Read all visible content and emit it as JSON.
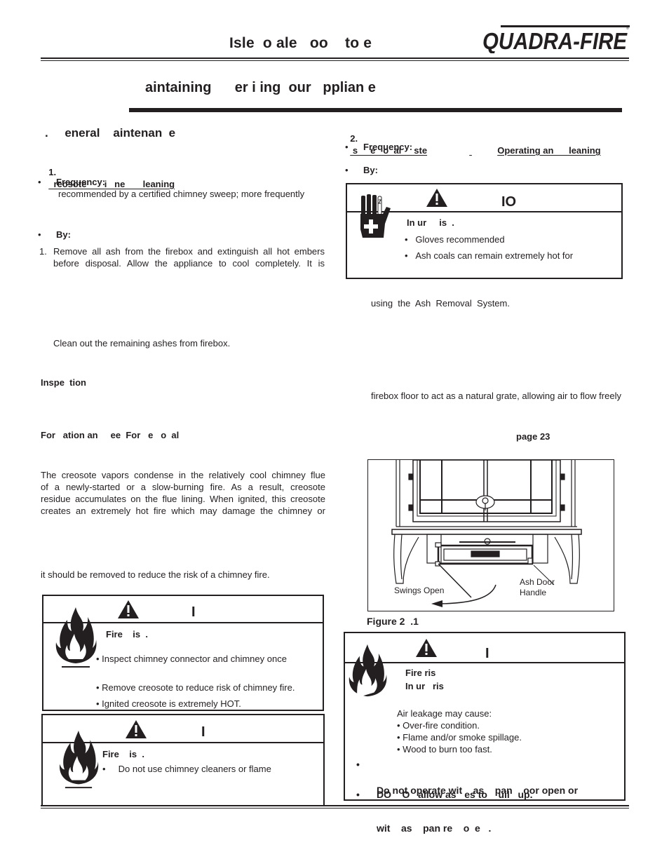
{
  "header": {
    "title": "Isle  o ale   oo    to e",
    "brand": "QUADRA-FIRE",
    "section_title": "aintaining      er i ing  our   pplian e"
  },
  "left": {
    "section_heading": ".     eneral    aintenan  e",
    "item1": {
      "number": "1.",
      "title": "  reosote       i   ne       leaning",
      "frequency_label": "Frequency:",
      "frequency_text": "recommended by a certified chimney sweep; more frequently",
      "by_label": "By:",
      "step1_num": "1.",
      "step1_line1": "Remove all ash from the firebox and extinguish all hot embers",
      "step1_line2": "before disposal. Allow the appliance to cool completely.  It is",
      "clean_out": "Clean out the remaining ashes from firebox."
    },
    "inspection_label": "Inspe  tion",
    "formation_label": "For   ation an     ee  For   e   o  al",
    "creosote_paragraph": [
      "The creosote vapors condense in the relatively cool chimney flue",
      "of a newly-started or a slow-burning fire.  As a result, creosote",
      "residue accumulates on the flue lining.  When ignited, this creosote",
      "creates an extremely hot fire which may damage the chimney or"
    ],
    "removal_sentence": "it should be removed to reduce the risk of a chimney fire.",
    "warning1": {
      "label": "I",
      "risk": "Fire    is  .",
      "bullets": [
        "Inspect chimney connector and chimney once",
        "Remove creosote to reduce risk of chimney fire.",
        "Ignited creosote is extremely HOT."
      ]
    },
    "warning2": {
      "label": "I",
      "risk": "Fire    is  .",
      "bullets": [
        "Do not use chimney cleaners or flame"
      ]
    }
  },
  "right": {
    "item2": {
      "number": "2.",
      "title_part1": " s     e   o  al     ste",
      "title_part2": "Operating an      leaning",
      "frequency_label": "Frequency:",
      "by_label": "By:"
    },
    "caution": {
      "label": "IO",
      "risk": "In ur     is  .",
      "bullets": [
        "Gloves recommended",
        "Ash coals can remain extremely hot for"
      ]
    },
    "ash_system_text": "using  the  Ash  Removal  System.",
    "grate_text": "firebox floor to act as a natural grate, allowing air to flow freely",
    "page_ref": "page 23",
    "figure": {
      "label_swings": "Swings Open",
      "label_handle_line1": "Ash Door",
      "label_handle_line2": "Handle",
      "caption": "Figure 2  .1"
    },
    "warning3": {
      "label": "I",
      "risk1": "Fire ris",
      "risk2": "In ur   ris",
      "air_leak": "Air leakage may cause:",
      "effects": [
        "Over-fire condition.",
        "Flame and/or smoke spillage.",
        "Wood to burn too fast."
      ],
      "bold1_line1": "Do not operate wit    as    pan    oor open or",
      "bold1_line2": "wit    as    pan re    o  e   .",
      "bold2": "DO    O   allow as   es to    uil   up."
    }
  }
}
